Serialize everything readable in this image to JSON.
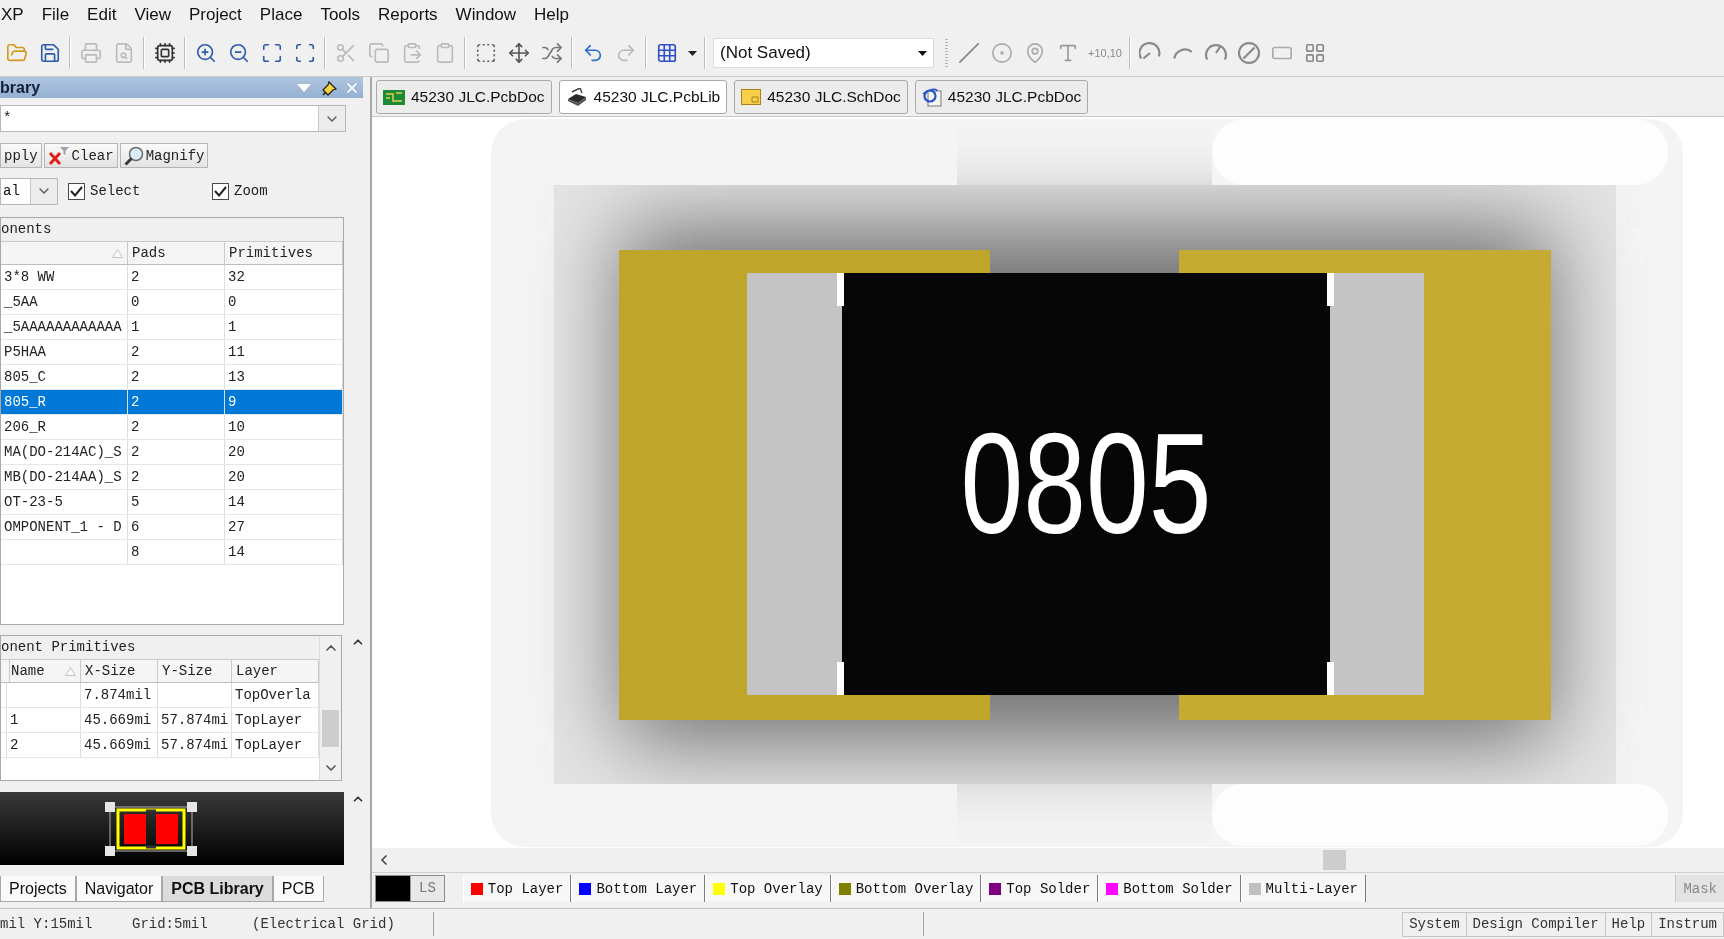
{
  "menu": [
    "XP",
    "File",
    "Edit",
    "View",
    "Project",
    "Place",
    "Tools",
    "Reports",
    "Window",
    "Help"
  ],
  "toolbar": [
    {
      "kind": "open",
      "disabled": false
    },
    {
      "kind": "save",
      "disabled": false
    },
    {
      "kind": "separator"
    },
    {
      "kind": "print",
      "disabled": true
    },
    {
      "kind": "preview",
      "disabled": true
    },
    {
      "kind": "separator"
    },
    {
      "kind": "board3d",
      "disabled": false
    },
    {
      "kind": "separator"
    },
    {
      "kind": "zoom_in",
      "disabled": false
    },
    {
      "kind": "zoom_out",
      "disabled": false
    },
    {
      "kind": "zoom_fit",
      "disabled": false
    },
    {
      "kind": "zoom_area",
      "disabled": false
    },
    {
      "kind": "separator"
    },
    {
      "kind": "cut",
      "disabled": true
    },
    {
      "kind": "copy",
      "disabled": true
    },
    {
      "kind": "paste",
      "disabled": true
    },
    {
      "kind": "paste_special",
      "disabled": true
    },
    {
      "kind": "separator"
    },
    {
      "kind": "select",
      "disabled": false
    },
    {
      "kind": "move",
      "disabled": false
    },
    {
      "kind": "deselect",
      "disabled": false
    },
    {
      "kind": "separator"
    },
    {
      "kind": "undo",
      "disabled": false
    },
    {
      "kind": "redo",
      "disabled": true
    },
    {
      "kind": "separator"
    },
    {
      "kind": "grid",
      "disabled": false
    },
    {
      "kind": "menu_caret",
      "disabled": false
    },
    {
      "kind": "separator"
    },
    {
      "kind": "dropdown",
      "value": "(Not Saved)"
    },
    {
      "kind": "grip"
    },
    {
      "kind": "line",
      "disabled": false
    },
    {
      "kind": "pad",
      "disabled": false
    },
    {
      "kind": "via",
      "disabled": false
    },
    {
      "kind": "text",
      "disabled": false
    },
    {
      "kind": "coordinate",
      "label": "+10,10",
      "disabled": false
    },
    {
      "kind": "separator"
    },
    {
      "kind": "arc_center",
      "disabled": false
    },
    {
      "kind": "arc_edge",
      "disabled": false
    },
    {
      "kind": "arc_any",
      "disabled": false
    },
    {
      "kind": "circle",
      "disabled": false
    },
    {
      "kind": "fill",
      "disabled": false
    },
    {
      "kind": "array",
      "disabled": false
    }
  ],
  "library_panel": {
    "title": "brary",
    "filter": {
      "value": "*"
    },
    "buttons": [
      {
        "kind": "apply",
        "label": "pply"
      },
      {
        "kind": "clear",
        "label": "Clear"
      },
      {
        "kind": "magnify",
        "label": "Magnify"
      }
    ],
    "mask_mode": {
      "value": "al"
    },
    "checkboxes": [
      {
        "label": "Select",
        "checked": true
      },
      {
        "label": "Zoom",
        "checked": true
      }
    ],
    "components": {
      "title": "onents",
      "columns": [
        "Pads",
        "Primitives"
      ],
      "rows": [
        {
          "name": "3*8 WW",
          "pads": "2",
          "primitives": "32",
          "selected": false
        },
        {
          "name": "_5AA",
          "pads": "0",
          "primitives": "0",
          "selected": false
        },
        {
          "name": "_5AAAAAAAAAAAA",
          "pads": "1",
          "primitives": "1",
          "selected": false
        },
        {
          "name": "P5HAA",
          "pads": "2",
          "primitives": "11",
          "selected": false
        },
        {
          "name": "805_C",
          "pads": "2",
          "primitives": "13",
          "selected": false
        },
        {
          "name": "805_R",
          "pads": "2",
          "primitives": "9",
          "selected": true
        },
        {
          "name": "206_R",
          "pads": "2",
          "primitives": "10",
          "selected": false
        },
        {
          "name": "MA(DO-214AC)_S",
          "pads": "2",
          "primitives": "20",
          "selected": false
        },
        {
          "name": "MB(DO-214AA)_S",
          "pads": "2",
          "primitives": "20",
          "selected": false
        },
        {
          "name": "OT-23-5",
          "pads": "5",
          "primitives": "14",
          "selected": false
        },
        {
          "name": "OMPONENT_1 - D",
          "pads": "6",
          "primitives": "27",
          "selected": false
        },
        {
          "pads": "8",
          "primitives": "14",
          "selected": false
        }
      ]
    },
    "primitives": {
      "title": "onent Primitives",
      "columns": [
        "Name",
        "X-Size",
        "Y-Size",
        "Layer"
      ],
      "rows": [
        {
          "x_size": "7.874mil",
          "layer": "TopOverla"
        },
        {
          "name": "1",
          "x_size": "45.669mi",
          "y_size": "57.874mi",
          "layer": "TopLayer"
        },
        {
          "name": "2",
          "x_size": "45.669mi",
          "y_size": "57.874mi",
          "layer": "TopLayer"
        }
      ]
    }
  },
  "panel_tabs": [
    {
      "label": "Projects",
      "selected": false
    },
    {
      "label": "Navigator",
      "selected": false
    },
    {
      "label": "PCB Library",
      "selected": true
    },
    {
      "label": "PCB",
      "selected": false
    }
  ],
  "document_tabs": [
    {
      "kind": "pcb",
      "label": "45230 JLC.PcbDoc",
      "selected": false
    },
    {
      "kind": "library",
      "label": "45230 JLC.PcbLib",
      "selected": true
    },
    {
      "kind": "schematic",
      "label": "45230 JLC.SchDoc",
      "selected": false
    },
    {
      "kind": "web",
      "label": "45230 JLC.PcbDoc",
      "selected": false
    }
  ],
  "canvas": {
    "component_label": "0805"
  },
  "layer_bar": {
    "current_layer": "LS",
    "layers": [
      {
        "label": "Top Layer",
        "color": "#ff0000"
      },
      {
        "label": "Bottom Layer",
        "color": "#0000ff"
      },
      {
        "label": "Top Overlay",
        "color": "#ffff00"
      },
      {
        "label": "Bottom Overlay",
        "color": "#808000"
      },
      {
        "label": "Top Solder",
        "color": "#800080"
      },
      {
        "label": "Bottom Solder",
        "color": "#ff00ff"
      },
      {
        "label": "Multi-Layer",
        "color": "#c0c0c0"
      }
    ],
    "mask": "Mask"
  },
  "status_bar": {
    "fields": [
      "mil Y:15mil",
      "Grid:5mil",
      "(Electrical Grid)"
    ],
    "buttons": [
      "System",
      "Design Compiler",
      "Help",
      "Instrum"
    ]
  }
}
